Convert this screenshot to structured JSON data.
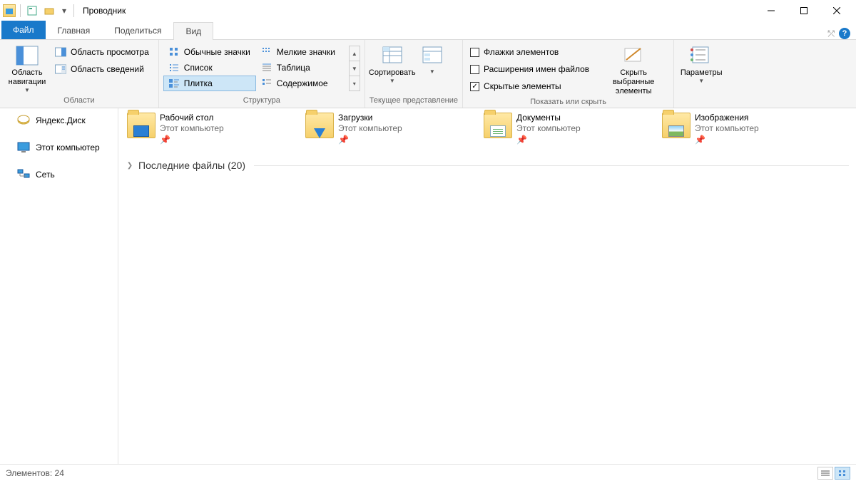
{
  "title": "Проводник",
  "tabs": {
    "file": "Файл",
    "home": "Главная",
    "share": "Поделиться",
    "view": "Вид"
  },
  "ribbon": {
    "panes": {
      "nav_pane": "Область навигации",
      "preview": "Область просмотра",
      "details": "Область сведений",
      "group_label": "Области"
    },
    "layouts": {
      "r0c0": "Обычные значки",
      "r0c1": "Мелкие значки",
      "r1c0": "Список",
      "r1c1": "Таблица",
      "r2c0": "Плитка",
      "r2c1": "Содержимое",
      "group_label": "Структура"
    },
    "currentview": {
      "sort": "Сортировать",
      "group_label": "Текущее представление"
    },
    "showhide": {
      "checkboxes": "Флажки элементов",
      "extensions": "Расширения имен файлов",
      "hidden": "Скрытые элементы",
      "hide_selected": "Скрыть выбранные элементы",
      "group_label": "Показать или скрыть"
    },
    "options": "Параметры"
  },
  "sidebar": {
    "yandex": "Яндекс.Диск",
    "thispc": "Этот компьютер",
    "network": "Сеть"
  },
  "folders": [
    {
      "name": "Рабочий стол",
      "sub": "Этот компьютер",
      "overlay": "monitor"
    },
    {
      "name": "Загрузки",
      "sub": "Этот компьютер",
      "overlay": "arrow"
    },
    {
      "name": "Документы",
      "sub": "Этот компьютер",
      "overlay": "doc"
    },
    {
      "name": "Изображения",
      "sub": "Этот компьютер",
      "overlay": "img"
    }
  ],
  "recent": "Последние файлы (20)",
  "statusbar": "Элементов: 24"
}
